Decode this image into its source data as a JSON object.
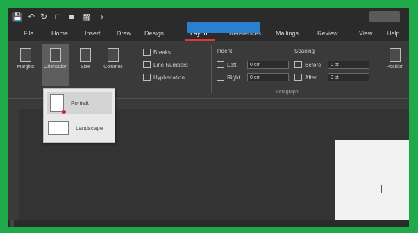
{
  "titlebar": {
    "qat_icons": [
      "save-icon",
      "undo-icon",
      "redo-icon",
      "new-document-icon",
      "open-folder-icon",
      "print-preview-icon",
      "more-icon"
    ],
    "tooltip": "",
    "account_label": ""
  },
  "tabs": [
    {
      "label": "File"
    },
    {
      "label": "Home"
    },
    {
      "label": "Insert"
    },
    {
      "label": "Draw"
    },
    {
      "label": "Design"
    },
    {
      "label": "Layout",
      "active": true
    },
    {
      "label": "References"
    },
    {
      "label": "Mailings"
    },
    {
      "label": "Review"
    },
    {
      "label": "View"
    },
    {
      "label": "Help"
    }
  ],
  "ribbon": {
    "margins": "Margins",
    "orientation": "Orientation",
    "size": "Size",
    "columns": "Columns",
    "breaks": "Breaks",
    "line_numbers": "Line Numbers",
    "hyphenation": "Hyphenation",
    "indent_title": "Indent",
    "spacing_title": "Spacing",
    "left_label": "Left",
    "right_label": "Right",
    "before_label": "Before",
    "after_label": "After",
    "left_value": "0 cm",
    "right_value": "0 cm",
    "before_value": "0 pt",
    "after_value": "0 pt",
    "page_setup_group": "",
    "paragraph_group": "Paragraph",
    "position_label": "Position"
  },
  "orientation_menu": {
    "portrait": "Portrait",
    "landscape": "Landscape"
  },
  "colors": {
    "frame_border": "#1faa4a",
    "accent_tab_underline": "#e0353b",
    "tooltip_blue": "#2a7fd0"
  }
}
